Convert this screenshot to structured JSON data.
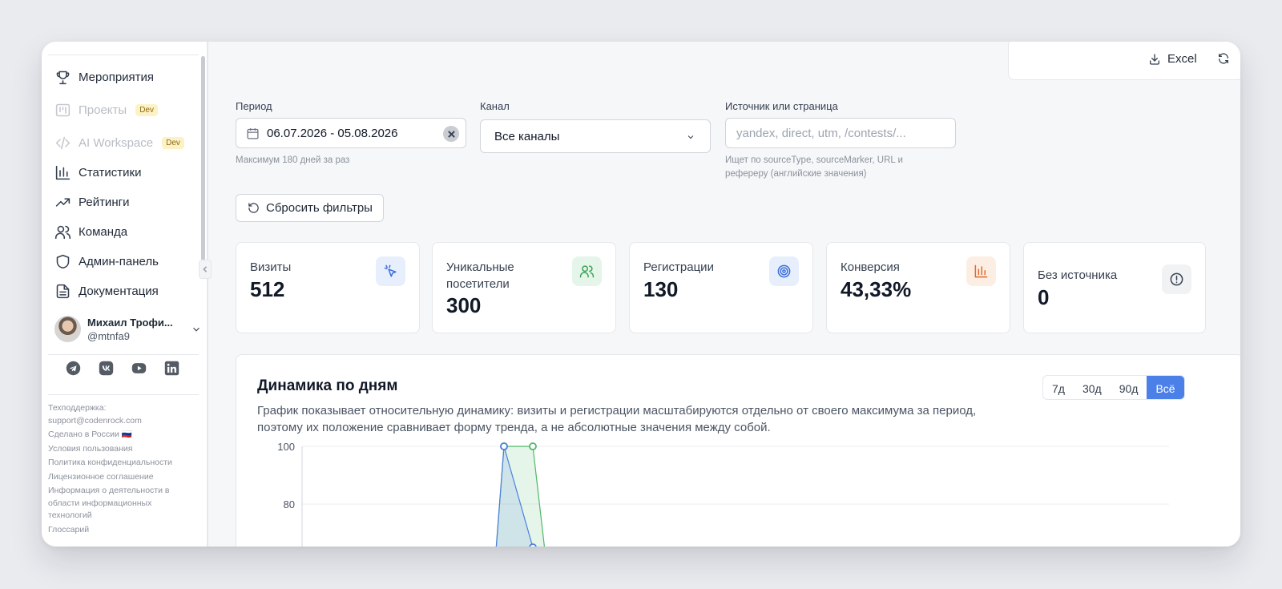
{
  "sidebar": {
    "items": [
      {
        "label": "Мероприятия",
        "icon": "trophy-icon"
      },
      {
        "label": "Проекты",
        "icon": "kanban-icon",
        "badge": "Dev"
      },
      {
        "label": "AI Workspace",
        "icon": "code-icon",
        "badge": "Dev"
      },
      {
        "label": "Статистики",
        "icon": "bar-chart-icon"
      },
      {
        "label": "Рейтинги",
        "icon": "trend-icon"
      },
      {
        "label": "Команда",
        "icon": "users-icon"
      },
      {
        "label": "Админ-панель",
        "icon": "shield-icon"
      },
      {
        "label": "Документация",
        "icon": "document-icon"
      }
    ],
    "user": {
      "name": "Михаил Трофи...",
      "handle": "@mtnfa9"
    },
    "socials": [
      "telegram-icon",
      "vk-icon",
      "youtube-icon",
      "linkedin-icon"
    ],
    "footer": {
      "support_label": "Техподдержка:",
      "support_email": "support@codenrock.com",
      "made_in": "Сделано в России 🇷🇺",
      "terms": "Условия пользования",
      "privacy": "Политика конфиденциальности",
      "license": "Лицензионное соглашение",
      "it_info": "Информация о деятельности в области информационных технологий",
      "glossary": "Глоссарий"
    }
  },
  "toolbar": {
    "excel_label": "Excel"
  },
  "filters": {
    "period": {
      "label": "Период",
      "value": "06.07.2026 - 05.08.2026",
      "hint": "Максимум 180 дней за раз"
    },
    "channel": {
      "label": "Канал",
      "value": "Все каналы"
    },
    "source": {
      "label": "Источник или страница",
      "placeholder": "yandex, direct, utm, /contests/...",
      "hint_line1": "Ищет по sourceType, sourceMarker, URL и",
      "hint_line2": "рефереру (английские значения)"
    },
    "reset_label": "Сбросить фильтры"
  },
  "kpis": [
    {
      "label_line1": "Визиты",
      "label_line2": "",
      "value": "512",
      "icon": "cursor-click-icon",
      "color": "#3b6fd8",
      "bg": "#e8effc"
    },
    {
      "label_line1": "Уникальные",
      "label_line2": "посетители",
      "value": "300",
      "icon": "users-icon",
      "color": "#3aa657",
      "bg": "#e6f5ea"
    },
    {
      "label_line1": "Регистрации",
      "label_line2": "",
      "value": "130",
      "icon": "target-icon",
      "color": "#3b6fd8",
      "bg": "#e8effc"
    },
    {
      "label_line1": "Конверсия",
      "label_line2": "",
      "value": "43,33%",
      "icon": "bar-chart-icon",
      "color": "#e06a2c",
      "bg": "#fdeee4"
    },
    {
      "label_line1": "Без источника",
      "label_line2": "",
      "value": "0",
      "icon": "alert-circle-icon",
      "color": "#374151",
      "bg": "#f1f2f4"
    }
  ],
  "chart": {
    "title": "Динамика по дням",
    "desc_line1": "График показывает относительную динамику: визиты и регистрации масштабируются отдельно от своего максимума за период,",
    "desc_line2": "поэтому их положение сравнивает форму тренда, а не абсолютные значения между собой.",
    "ranges": [
      "7д",
      "30д",
      "90д",
      "Всё"
    ],
    "active_range": "Всё"
  },
  "chart_data": {
    "type": "area",
    "title": "Динамика по дням",
    "ylim": [
      0,
      100
    ],
    "yticks_visible": [
      100,
      80
    ],
    "grid": true,
    "series": [
      {
        "name": "",
        "color": "#4fb867",
        "visible_points": [
          {
            "i": 10,
            "y": 100
          },
          {
            "i": 11,
            "y": 100
          }
        ]
      },
      {
        "name": "",
        "color": "#4a7fe0",
        "visible_points": [
          {
            "i": 10,
            "y": 100
          },
          {
            "i": 11,
            "y": 65
          }
        ]
      }
    ]
  }
}
